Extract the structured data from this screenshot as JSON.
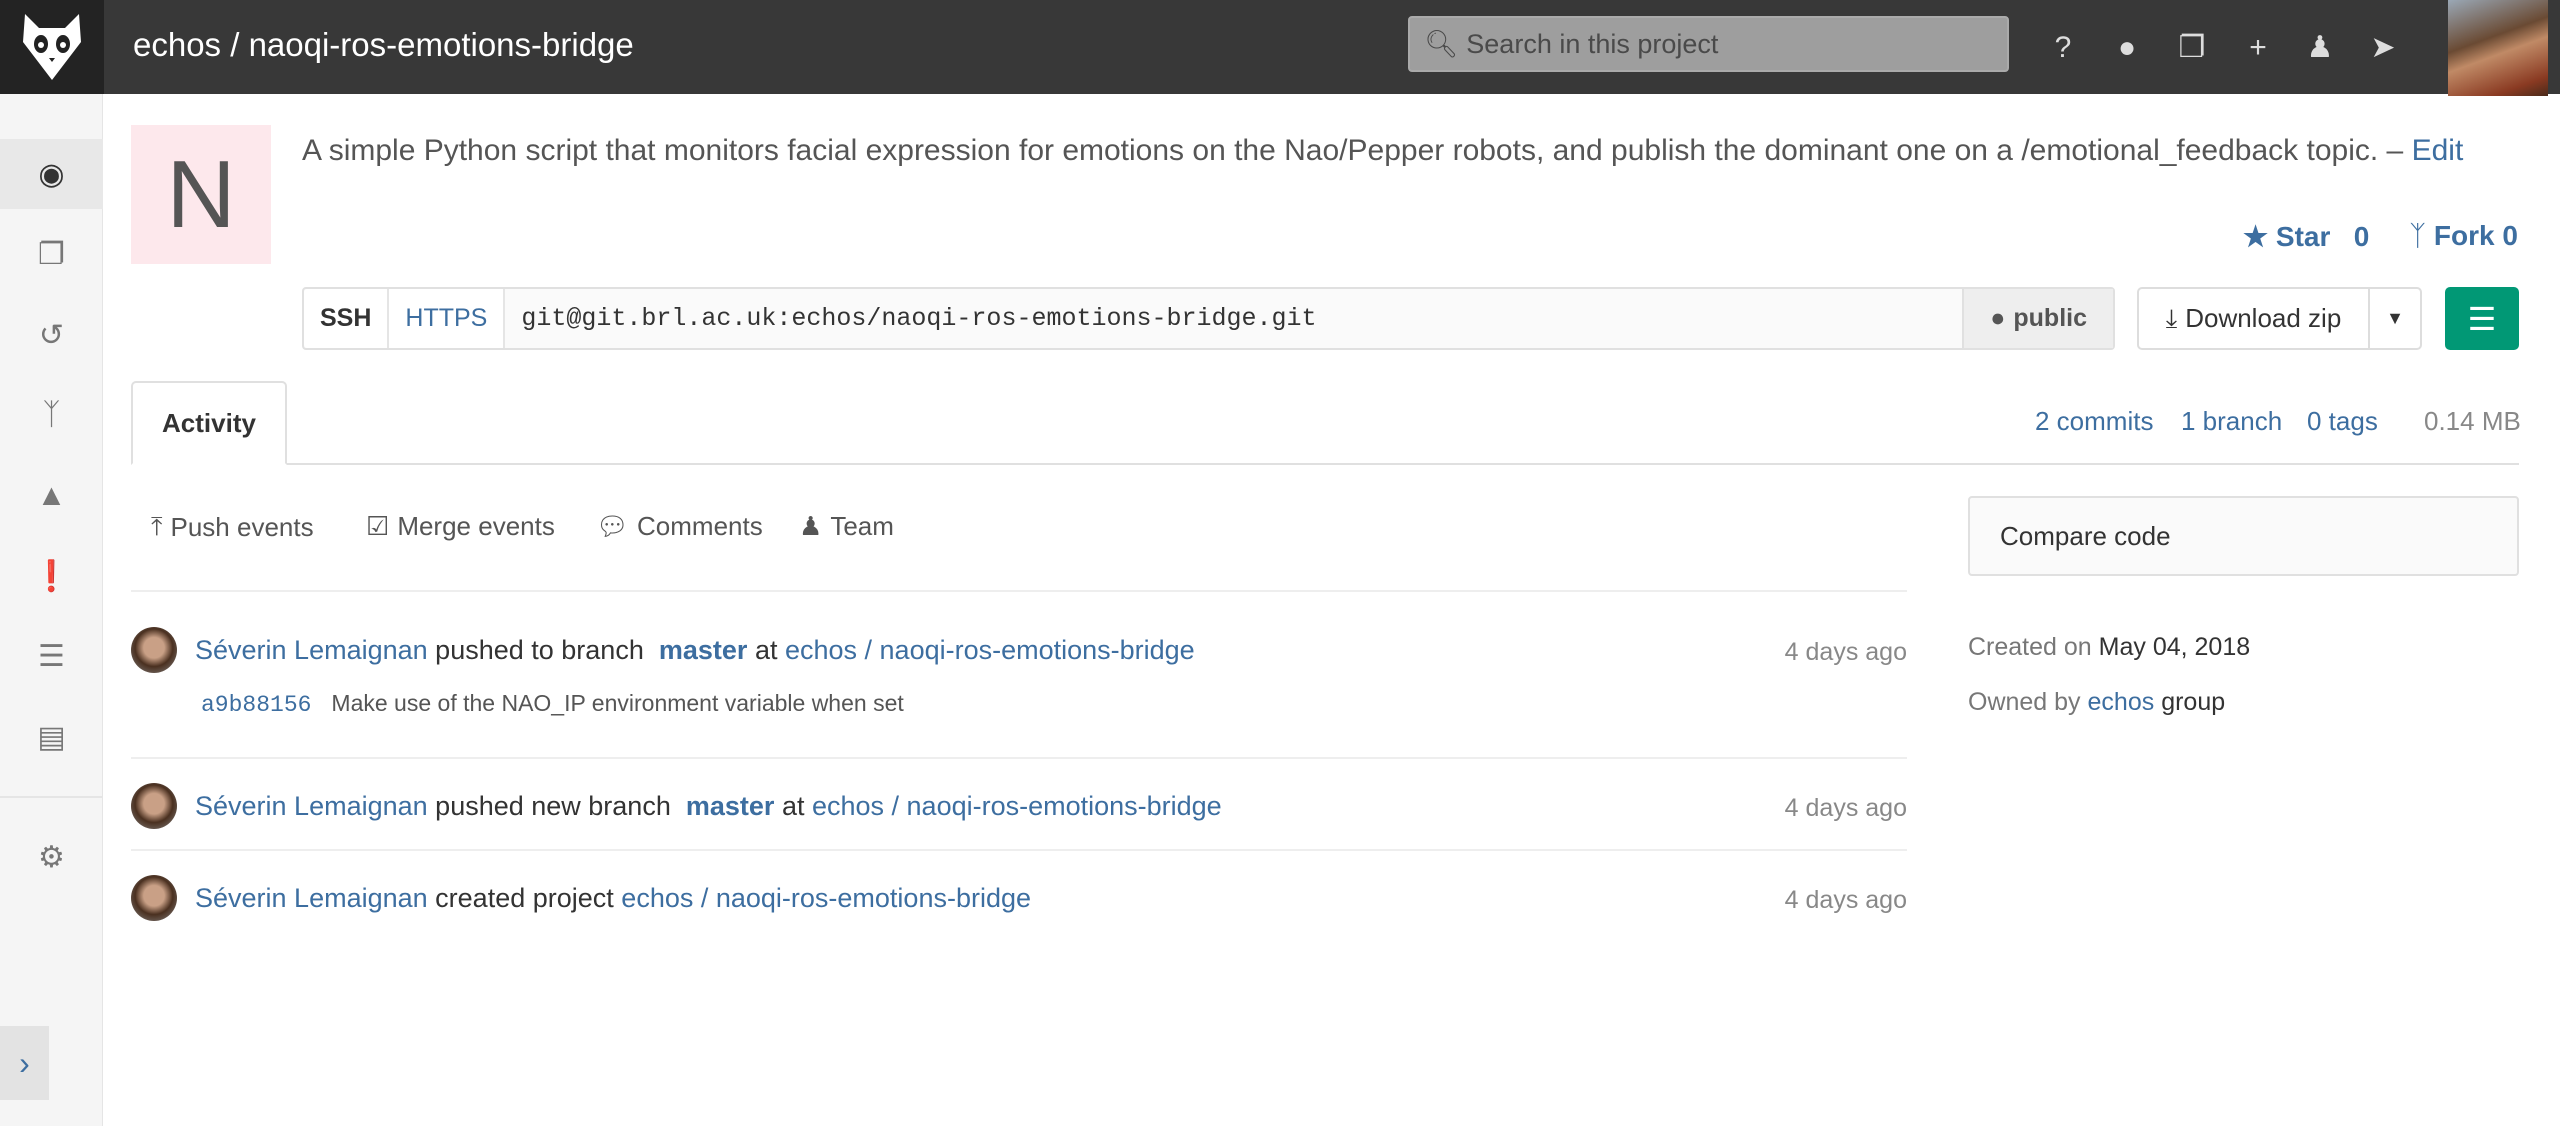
{
  "header": {
    "title": "echos / naoqi-ros-emotions-bridge",
    "search_placeholder": "Search in this project",
    "icons": [
      "help-icon",
      "globe-icon",
      "snippets-icon",
      "plus-icon",
      "user-icon",
      "sign-out-icon"
    ]
  },
  "sidebar": {
    "items": [
      "dashboard-icon",
      "files-icon",
      "commits-icon",
      "branch-icon",
      "graphs-icon",
      "issues-icon",
      "merge-list-icon",
      "wiki-icon"
    ],
    "settings": "cogs-icon",
    "collapse": "›"
  },
  "project": {
    "avatar_letter": "N",
    "description": "A simple Python script that monitors facial expression for emotions on the Nao/Pepper robots, and publish the dominant one on a /emotional_feedback topic.",
    "desc_sep": " – ",
    "edit": "Edit",
    "star_label": "Star",
    "star_count": "0",
    "fork_label": "Fork",
    "fork_count": "0"
  },
  "clone": {
    "ssh": "SSH",
    "https": "HTTPS",
    "url": "git@git.brl.ac.uk:echos/naoqi-ros-emotions-bridge.git",
    "visibility": "public"
  },
  "download": {
    "label": "Download zip"
  },
  "tabs": {
    "activity": "Activity"
  },
  "stats": {
    "commits": "2 commits",
    "branches": "1 branch",
    "tags": "0 tags",
    "size": "0.14 MB"
  },
  "filters": [
    "Push events",
    "Merge events",
    "Comments",
    "Team"
  ],
  "events": [
    {
      "author": "Séverin Lemaignan",
      "action": "pushed to branch",
      "branch": "master",
      "at": "at",
      "project": "echos / naoqi-ros-emotions-bridge",
      "time": "4 days ago",
      "commit_sha": "a9b88156",
      "commit_msg": "Make use of the NAO_IP environment variable when set"
    },
    {
      "author": "Séverin Lemaignan",
      "action": "pushed new branch",
      "branch": "master",
      "at": "at",
      "project": "echos / naoqi-ros-emotions-bridge",
      "time": "4 days ago"
    },
    {
      "author": "Séverin Lemaignan",
      "action": "created project",
      "project": "echos / naoqi-ros-emotions-bridge",
      "time": "4 days ago"
    }
  ],
  "side": {
    "compare": "Compare code",
    "created_label": "Created on",
    "created_date": "May 04, 2018",
    "owned_label": "Owned by",
    "owner": "echos",
    "owner_suffix": "group"
  },
  "colors": {
    "header": "#383838",
    "accent": "#019875",
    "link": "#3d6ea0"
  }
}
